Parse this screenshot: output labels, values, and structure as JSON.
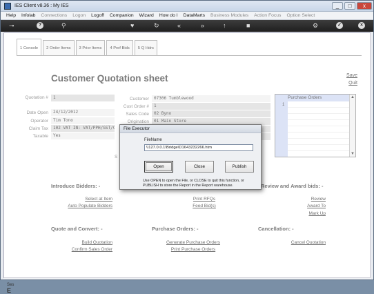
{
  "window": {
    "title": "IES Client v8.36 : My IES",
    "min": "_",
    "max": "□",
    "close": "x"
  },
  "menu": [
    "Help",
    "Infolab",
    "Connections",
    "Logon",
    "Logoff",
    "Companion",
    "Wizard",
    "How do I",
    "DataMarts",
    "Business Modules",
    "Action Focus",
    "Option Select"
  ],
  "menu_dim": [
    false,
    false,
    true,
    true,
    false,
    false,
    false,
    false,
    false,
    true,
    true,
    true
  ],
  "tabs": [
    "1 Console",
    "2 Order Items",
    "3 Prior Items",
    "4 Pref Bids",
    "5 Q Hdrs"
  ],
  "page": {
    "title": "Customer Quotation sheet",
    "save": "Save",
    "quit": "Quit"
  },
  "form": {
    "quotation_label": "Quotation #",
    "quotation_value": "1",
    "date_open_label": "Date Open",
    "date_open_value": "24/12/2012",
    "operator_label": "Operator",
    "operator_value": "Tim Tono",
    "claim_tax_label": "Claim Tax",
    "claim_tax_value": "102 VAT IN: VAT/PPH/GST/C",
    "taxable_label": "Taxable",
    "taxable_value": "Yes",
    "customer_label": "Customer",
    "customer_value": "07306 Tumblewood",
    "cust_order_label": "Cust Order #",
    "cust_order_value": "1",
    "sales_code_label": "Sales Code",
    "sales_code_value": "02 Byno",
    "origination_label": "Origination",
    "origination_value": "01 Main Store",
    "s_label": "S"
  },
  "purchase_orders": {
    "header": "Purchase Orders",
    "row_number": "1"
  },
  "sections": {
    "introduce": "Introduce Bidders: -",
    "review": "Review and Award bids: -",
    "quote": "Quote and Convert: -",
    "purchase": "Purchase Orders: -",
    "cancel": "Cancellation: -"
  },
  "links": {
    "select_item": "Select at Item",
    "auto_populate": "Auto Populate Bidders",
    "print_rfqs": "Print RFQs",
    "feed_bids": "Feed Bid(s)",
    "review": "Review",
    "award_to": "Award To",
    "mark_up": "Mark Up",
    "build_quotation": "Build Quotation",
    "confirm_sales_order": "Confirm Sales Order",
    "generate_po": "Generate Purchase Orders",
    "print_po": "Print Purchase Orders",
    "cancel_quotation": "Cancel Quotation"
  },
  "dialog": {
    "title": "File Executor",
    "file_label": "FileName",
    "file_value": "\\\\127.0.0.1\\Bridge\\D1643232266.htm",
    "open": "Open",
    "close": "Close",
    "publish": "Publish",
    "message": "Use OPEN to open the File, or CLOSE to quit this function, or PUBLISH to store the Report in the Report warehouse."
  },
  "left_bits": {
    "a": "Ses",
    "b": "E"
  },
  "colors": {
    "toolbar": "#2a2a2a",
    "po_header": "#c9d4f2",
    "field": "#d8d8d8"
  }
}
